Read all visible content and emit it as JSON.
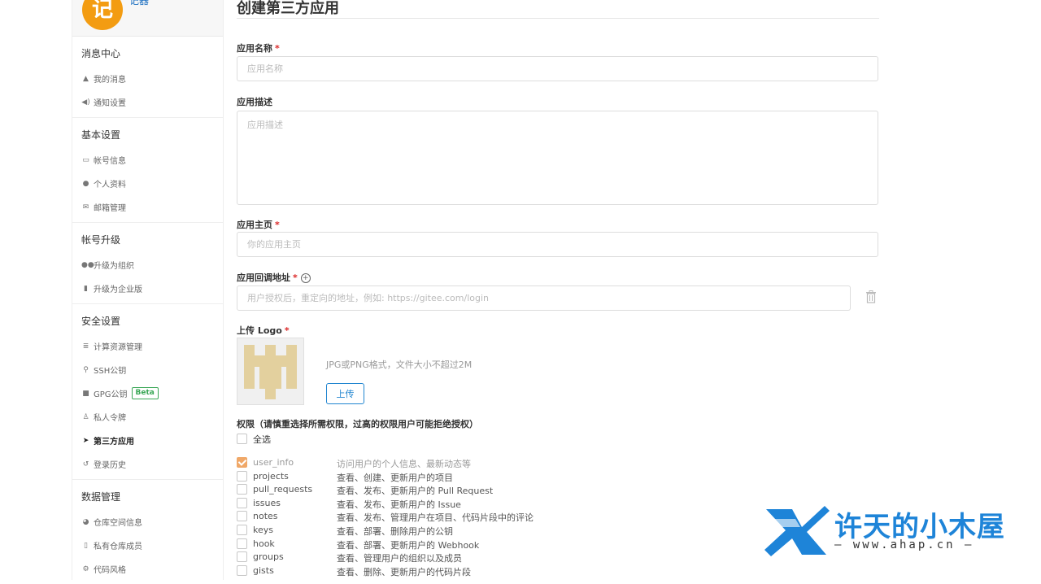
{
  "sidebar": {
    "avatar_char": "记",
    "user_name": "记器",
    "groups": [
      {
        "title": "消息中心",
        "items": [
          {
            "label": "我的消息",
            "icon": "bell-icon"
          },
          {
            "label": "通知设置",
            "icon": "speaker-icon"
          }
        ]
      },
      {
        "title": "基本设置",
        "items": [
          {
            "label": "帐号信息",
            "icon": "id-card-icon"
          },
          {
            "label": "个人资料",
            "icon": "user-icon"
          },
          {
            "label": "邮箱管理",
            "icon": "mail-icon"
          }
        ]
      },
      {
        "title": "帐号升级",
        "items": [
          {
            "label": "升级为组织",
            "icon": "users-icon"
          },
          {
            "label": "升级为企业版",
            "icon": "building-icon"
          }
        ]
      },
      {
        "title": "安全设置",
        "items": [
          {
            "label": "计算资源管理",
            "icon": "server-icon"
          },
          {
            "label": "SSH公钥",
            "icon": "wrench-icon"
          },
          {
            "label": "GPG公钥",
            "icon": "lock-icon",
            "badge": "Beta"
          },
          {
            "label": "私人令牌",
            "icon": "sitemap-icon"
          },
          {
            "label": "第三方应用",
            "icon": "rocket-icon",
            "active": true
          },
          {
            "label": "登录历史",
            "icon": "history-icon"
          }
        ]
      },
      {
        "title": "数据管理",
        "items": [
          {
            "label": "仓库空间信息",
            "icon": "pie-chart-icon"
          },
          {
            "label": "私有仓库成员",
            "icon": "member-icon"
          },
          {
            "label": "代码风格",
            "icon": "style-icon"
          }
        ]
      }
    ]
  },
  "form": {
    "title": "创建第三方应用",
    "name": {
      "label": "应用名称",
      "required": "*",
      "placeholder": "应用名称"
    },
    "description": {
      "label": "应用描述",
      "placeholder": "应用描述"
    },
    "homepage": {
      "label": "应用主页",
      "required": "*",
      "placeholder": "你的应用主页"
    },
    "callback": {
      "label": "应用回调地址",
      "required": "*",
      "placeholder": "用户授权后，重定向的地址，例如: https://gitee.com/login"
    },
    "logo": {
      "label": "上传 Logo",
      "required": "*",
      "hint": "JPG或PNG格式，文件大小不超过2M",
      "upload_label": "上传"
    },
    "permissions": {
      "title": "权限（请慎重选择所需权限，过高的权限用户可能拒绝授权）",
      "select_all": "全选",
      "items": [
        {
          "name": "user_info",
          "desc": "访问用户的个人信息、最新动态等",
          "checked": true
        },
        {
          "name": "projects",
          "desc": "查看、创建、更新用户的项目",
          "checked": false
        },
        {
          "name": "pull_requests",
          "desc": "查看、发布、更新用户的 Pull Request",
          "checked": false
        },
        {
          "name": "issues",
          "desc": "查看、发布、更新用户的 Issue",
          "checked": false
        },
        {
          "name": "notes",
          "desc": "查看、发布、管理用户在项目、代码片段中的评论",
          "checked": false
        },
        {
          "name": "keys",
          "desc": "查看、部署、删除用户的公钥",
          "checked": false
        },
        {
          "name": "hook",
          "desc": "查看、部署、更新用户的 Webhook",
          "checked": false
        },
        {
          "name": "groups",
          "desc": "查看、管理用户的组织以及成员",
          "checked": false
        },
        {
          "name": "gists",
          "desc": "查看、删除、更新用户的代码片段",
          "checked": false
        }
      ]
    }
  },
  "watermark": {
    "title": "许天的小木屋",
    "subtitle": "— www.ahap.cn —"
  },
  "colors": {
    "accent": "#2185d0",
    "required": "#db2828",
    "avatar": "#f39c12",
    "checked": "#f0a868",
    "beta": "#3aa756",
    "watermark": "#1e84d8"
  }
}
